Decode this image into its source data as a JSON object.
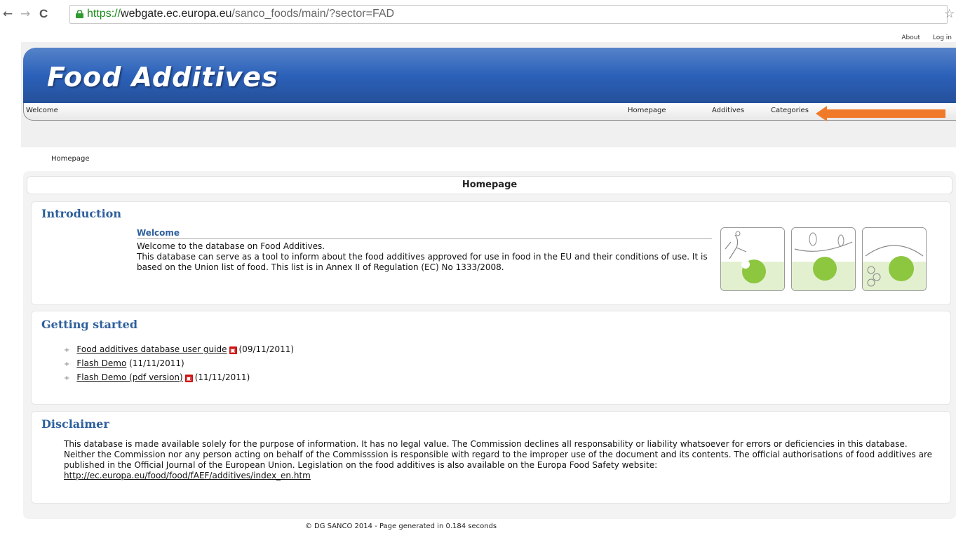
{
  "browser": {
    "url_scheme": "https://",
    "url_host": "webgate.ec.europa.eu",
    "url_path": "/sanco_foods/main/?sector=FAD",
    "back_glyph": "←",
    "forward_glyph": "→",
    "reload_glyph": "C",
    "star_glyph": "☆"
  },
  "toplinks": {
    "about": "About",
    "login": "Log in"
  },
  "header": {
    "title": "Food Additives"
  },
  "navbar": {
    "welcome": "Welcome",
    "homepage": "Homepage",
    "additives": "Additives",
    "categories": "Categories"
  },
  "annotation": {
    "arrow_color": "#f07a2a"
  },
  "breadcrumb": "Homepage",
  "main": {
    "heading": "Homepage",
    "introduction": {
      "title": "Introduction",
      "welcome_heading": "Welcome",
      "line1": "Welcome to the database on Food Additives.",
      "line2": "This database can serve as a tool to inform about the food additives approved for use in food in the EU and their conditions of use. It is based on the Union list of food. This list is in Annex II of Regulation (EC) No 1333/2008."
    },
    "getting_started": {
      "title": "Getting started",
      "items": [
        {
          "link": "Food additives database user guide",
          "pdf": true,
          "date": "(09/11/2011)"
        },
        {
          "link": "Flash Demo",
          "pdf": false,
          "date": "(11/11/2011)"
        },
        {
          "link": "Flash Demo (pdf version)",
          "pdf": true,
          "date": "(11/11/2011)"
        }
      ]
    },
    "disclaimer": {
      "title": "Disclaimer",
      "text": "This database is made available solely for the purpose of information. It has no legal value. The Commission declines all responsability or liability whatsoever for errors or deficiencies in this database. Neither the Commission nor any person acting on behalf of the Commisssion is responsible with regard to the improper use of the document and its contents. The official authorisations of food additives are published in the Official Journal of the European Union. Legislation on the food additives is also available on the Europa Food Safety website:",
      "link": "http://ec.europa.eu/food/food/fAEF/additives/index_en.htm"
    }
  },
  "footer": "© DG SANCO 2014 - Page generated in 0.184 seconds",
  "colors": {
    "banner": "#2b61b9",
    "section_title": "#2d5f9c",
    "apple_green": "#8dc63f",
    "thumb_bg": "#e3f0d0"
  }
}
